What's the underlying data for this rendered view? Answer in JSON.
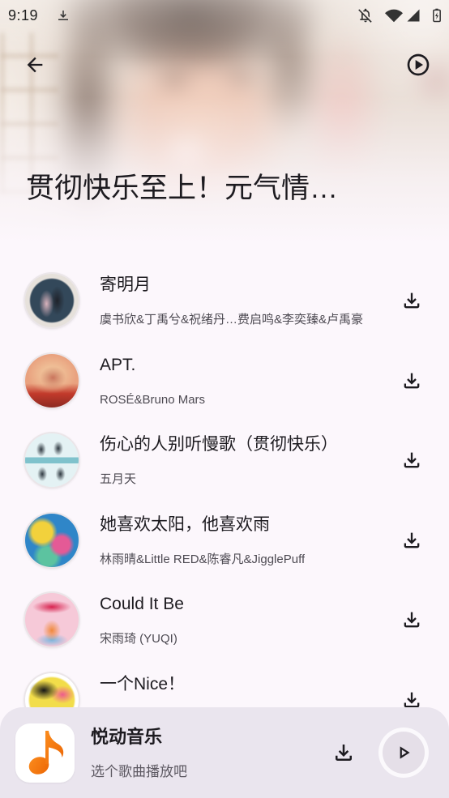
{
  "status_bar": {
    "time": "9:19",
    "left_icons": [
      "download-icon"
    ],
    "right_icons": [
      "notifications-off-icon",
      "wifi-icon",
      "cellular-signal-icon",
      "battery-charging-icon"
    ]
  },
  "header": {
    "title": "贯彻快乐至上！元气情…",
    "back_icon": "back-arrow-icon",
    "play_all_icon": "play-circle-icon"
  },
  "songs": [
    {
      "title": "寄明月",
      "artist": "虞书欣&丁禹兮&祝绪丹…费启鸣&李奕臻&卢禹豪",
      "action_icon": "download-icon",
      "cover_colors": [
        "#33485a",
        "#d8b2bc",
        "#1f222a",
        "#e6e1db"
      ]
    },
    {
      "title": "APT.",
      "artist": "ROSÉ&Bruno Mars",
      "action_icon": "download-icon",
      "cover_colors": [
        "#e9a27f",
        "#f3d2a6",
        "#c23a2b",
        "#8c2a22"
      ]
    },
    {
      "title": "伤心的人别听慢歌（贯彻快乐）",
      "artist": "五月天",
      "action_icon": "download-icon",
      "cover_colors": [
        "#7fc2cc",
        "#2e3840",
        "#e4f2f4",
        "#ffffff"
      ]
    },
    {
      "title": "她喜欢太阳，他喜欢雨",
      "artist": "林雨晴&Little RED&陈睿凡&JigglePuff",
      "action_icon": "download-icon",
      "cover_colors": [
        "#2f86c8",
        "#f2d13c",
        "#e45a96",
        "#5cc3a0"
      ]
    },
    {
      "title": "Could It Be",
      "artist": "宋雨琦 (YUQI)",
      "action_icon": "download-icon",
      "cover_colors": [
        "#f6c9d8",
        "#d8234f",
        "#f0883a",
        "#7ab6e0"
      ]
    },
    {
      "title": "一个Nice！",
      "action_icon": "download-icon",
      "cover_colors": [
        "#f2dd4a",
        "#161616",
        "#ee5b8d",
        "#ffffff"
      ]
    }
  ],
  "player": {
    "app_name": "悦动音乐",
    "hint": "选个歌曲播放吧",
    "logo_icon": "music-note-icon",
    "download_icon": "download-icon",
    "play_icon": "play-icon"
  },
  "colors": {
    "page_background": "#fcf7fc",
    "player_background": "#eae5ee",
    "text_primary": "#1d1b20",
    "text_secondary": "#4d4a52",
    "accent": "#fb8c1e",
    "accent_dark": "#ec6604"
  }
}
